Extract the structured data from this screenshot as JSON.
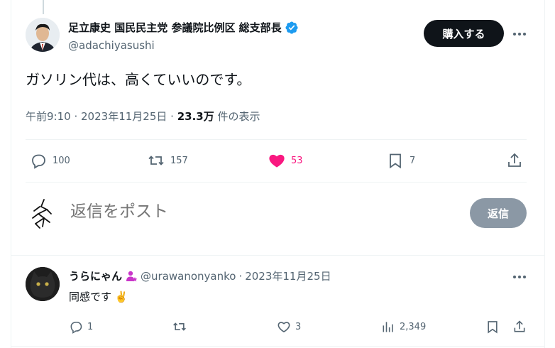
{
  "tweet": {
    "author_name": "足立康史 国民民主党 参議院比例区 総支部長",
    "handle": "@adachiyasushi",
    "buy_label": "購入する",
    "text": "ガソリン代は、高くていいのです。",
    "time": "午前9:10",
    "date": "2023年11月25日",
    "views_count": "23.3万",
    "views_label": "件の表示",
    "stats": {
      "replies": "100",
      "reposts": "157",
      "likes": "53",
      "bookmarks": "7"
    }
  },
  "composer": {
    "placeholder": "返信をポスト",
    "reply_button": "返信"
  },
  "reply": {
    "name": "うらにゃん",
    "handle": "@urawanonyanko",
    "date": "2023年11月25日",
    "text": "同感です",
    "emoji": "✌️",
    "stats": {
      "replies": "1",
      "likes": "3",
      "views": "2,349"
    }
  },
  "colors": {
    "verified": "#1d9bf0",
    "like": "#f91880",
    "muted": "#536471",
    "button_dark": "#0f1419",
    "button_disabled": "#8b98a5",
    "badge": "#c935c9"
  }
}
